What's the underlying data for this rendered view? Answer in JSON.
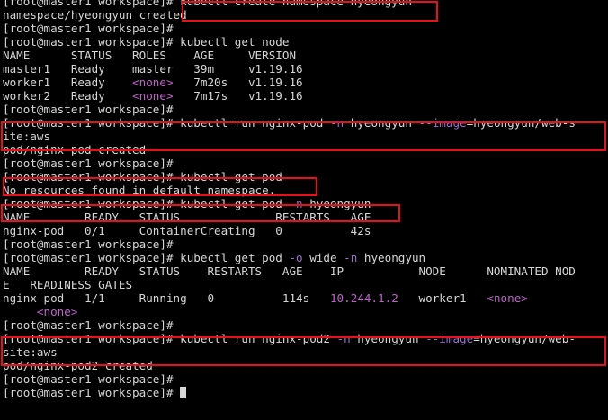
{
  "colors": {
    "background": "#000000",
    "foreground": "#d6d6d6",
    "magenta": "#c061cb",
    "flag": "#9b6fd0",
    "highlight_box": "#e8101a"
  },
  "lines": [
    [
      {
        "t": "[root@master1 workspace]# kubectl create namespace hyeongyun"
      }
    ],
    [
      {
        "t": "namespace/hyeongyun created"
      }
    ],
    [
      {
        "t": "[root@master1 workspace]#"
      }
    ],
    [
      {
        "t": "[root@master1 workspace]# kubectl get node"
      }
    ],
    [
      {
        "t": "NAME      STATUS   ROLES    AGE     VERSION"
      }
    ],
    [
      {
        "t": "master1   Ready    master   39m     v1.19.16"
      }
    ],
    [
      {
        "t": "worker1   Ready    "
      },
      {
        "t": "<none>",
        "c": "magenta"
      },
      {
        "t": "   7m20s   v1.19.16"
      }
    ],
    [
      {
        "t": "worker2   Ready    "
      },
      {
        "t": "<none>",
        "c": "magenta"
      },
      {
        "t": "   7m17s   v1.19.16"
      }
    ],
    [
      {
        "t": "[root@master1 workspace]#"
      }
    ],
    [
      {
        "t": "[root@master1 workspace]# kubectl run nginx-pod "
      },
      {
        "t": "-n",
        "c": "flag"
      },
      {
        "t": " hyeongyun "
      },
      {
        "t": "--image",
        "c": "flag"
      },
      {
        "t": "=hyeongyun/web-s"
      }
    ],
    [
      {
        "t": "ite:aws"
      }
    ],
    [
      {
        "t": "pod/nginx-pod created"
      }
    ],
    [
      {
        "t": "[root@master1 workspace]#"
      }
    ],
    [
      {
        "t": "[root@master1 workspace]# kubectl get pod"
      }
    ],
    [
      {
        "t": "No resources found in default namespace."
      }
    ],
    [
      {
        "t": "[root@master1 workspace]# kubectl get pod "
      },
      {
        "t": "-n",
        "c": "flag"
      },
      {
        "t": " hyeongyun"
      }
    ],
    [
      {
        "t": "NAME        READY   STATUS              RESTARTS   AGE"
      }
    ],
    [
      {
        "t": "nginx-pod   0/1     ContainerCreating   0          42s"
      }
    ],
    [
      {
        "t": "[root@master1 workspace]#"
      }
    ],
    [
      {
        "t": "[root@master1 workspace]# kubectl get pod "
      },
      {
        "t": "-o",
        "c": "flag"
      },
      {
        "t": " wide "
      },
      {
        "t": "-n",
        "c": "flag"
      },
      {
        "t": " hyeongyun"
      }
    ],
    [
      {
        "t": "NAME        READY   STATUS    RESTARTS   AGE    IP           NODE      NOMINATED NOD"
      }
    ],
    [
      {
        "t": "E   READINESS GATES"
      }
    ],
    [
      {
        "t": "nginx-pod   1/1     Running   0          114s   "
      },
      {
        "t": "10.244.1.2",
        "c": "magenta"
      },
      {
        "t": "   worker1   "
      },
      {
        "t": "<none>",
        "c": "magenta"
      }
    ],
    [
      {
        "t": "     "
      },
      {
        "t": "<none>",
        "c": "magenta"
      }
    ],
    [
      {
        "t": "[root@master1 workspace]#"
      }
    ],
    [
      {
        "t": "[root@master1 workspace]# kubectl run nginx-pod2 "
      },
      {
        "t": "-n",
        "c": "flag"
      },
      {
        "t": " hyeongyun "
      },
      {
        "t": "--image",
        "c": "flag"
      },
      {
        "t": "=hyeongyun/web-"
      }
    ],
    [
      {
        "t": "site:aws"
      }
    ],
    [
      {
        "t": "pod/nginx-pod2 created"
      }
    ],
    [
      {
        "t": "[root@master1 workspace]#"
      }
    ],
    [
      {
        "t": "[root@master1 workspace]# "
      }
    ]
  ]
}
